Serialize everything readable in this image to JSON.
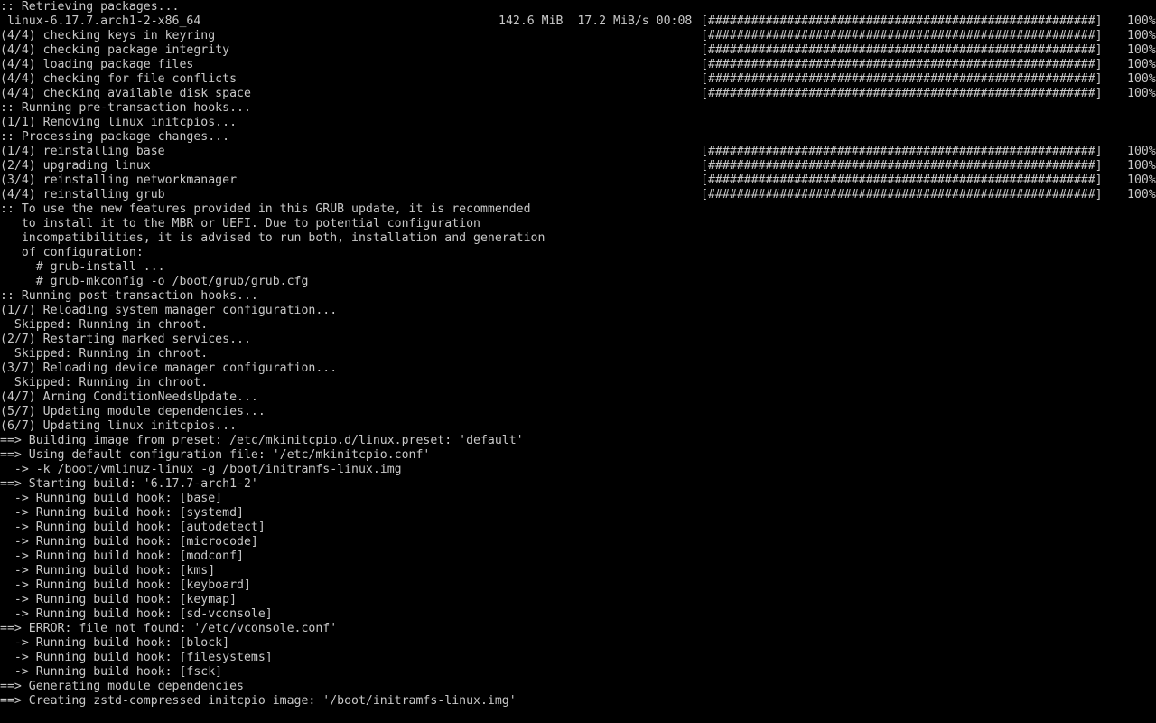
{
  "colors": {
    "background": "#000000",
    "text": "#c8c8c8"
  },
  "console": {
    "lines": [
      {
        "text": ":: Retrieving packages..."
      },
      {
        "text": " linux-6.17.7.arch1-2-x86_64",
        "stats": "142.6 MiB  17.2 MiB/s 00:08",
        "bar": "[######################################################]",
        "pct": "100%"
      },
      {
        "text": "(4/4) checking keys in keyring",
        "bar": "[######################################################]",
        "pct": "100%"
      },
      {
        "text": "(4/4) checking package integrity",
        "bar": "[######################################################]",
        "pct": "100%"
      },
      {
        "text": "(4/4) loading package files",
        "bar": "[######################################################]",
        "pct": "100%"
      },
      {
        "text": "(4/4) checking for file conflicts",
        "bar": "[######################################################]",
        "pct": "100%"
      },
      {
        "text": "(4/4) checking available disk space",
        "bar": "[######################################################]",
        "pct": "100%"
      },
      {
        "text": ":: Running pre-transaction hooks..."
      },
      {
        "text": "(1/1) Removing linux initcpios..."
      },
      {
        "text": ":: Processing package changes..."
      },
      {
        "text": "(1/4) reinstalling base",
        "bar": "[######################################################]",
        "pct": "100%"
      },
      {
        "text": "(2/4) upgrading linux",
        "bar": "[######################################################]",
        "pct": "100%"
      },
      {
        "text": "(3/4) reinstalling networkmanager",
        "bar": "[######################################################]",
        "pct": "100%"
      },
      {
        "text": "(4/4) reinstalling grub",
        "bar": "[######################################################]",
        "pct": "100%"
      },
      {
        "text": ":: To use the new features provided in this GRUB update, it is recommended"
      },
      {
        "text": "   to install it to the MBR or UEFI. Due to potential configuration"
      },
      {
        "text": "   incompatibilities, it is advised to run both, installation and generation"
      },
      {
        "text": "   of configuration:"
      },
      {
        "text": "     # grub-install ..."
      },
      {
        "text": "     # grub-mkconfig -o /boot/grub/grub.cfg"
      },
      {
        "text": ":: Running post-transaction hooks..."
      },
      {
        "text": "(1/7) Reloading system manager configuration..."
      },
      {
        "text": "  Skipped: Running in chroot."
      },
      {
        "text": "(2/7) Restarting marked services..."
      },
      {
        "text": "  Skipped: Running in chroot."
      },
      {
        "text": "(3/7) Reloading device manager configuration..."
      },
      {
        "text": "  Skipped: Running in chroot."
      },
      {
        "text": "(4/7) Arming ConditionNeedsUpdate..."
      },
      {
        "text": "(5/7) Updating module dependencies..."
      },
      {
        "text": "(6/7) Updating linux initcpios..."
      },
      {
        "text": "==> Building image from preset: /etc/mkinitcpio.d/linux.preset: 'default'"
      },
      {
        "text": "==> Using default configuration file: '/etc/mkinitcpio.conf'"
      },
      {
        "text": "  -> -k /boot/vmlinuz-linux -g /boot/initramfs-linux.img"
      },
      {
        "text": "==> Starting build: '6.17.7-arch1-2'"
      },
      {
        "text": "  -> Running build hook: [base]"
      },
      {
        "text": "  -> Running build hook: [systemd]"
      },
      {
        "text": "  -> Running build hook: [autodetect]"
      },
      {
        "text": "  -> Running build hook: [microcode]"
      },
      {
        "text": "  -> Running build hook: [modconf]"
      },
      {
        "text": "  -> Running build hook: [kms]"
      },
      {
        "text": "  -> Running build hook: [keyboard]"
      },
      {
        "text": "  -> Running build hook: [keymap]"
      },
      {
        "text": "  -> Running build hook: [sd-vconsole]"
      },
      {
        "text": "==> ERROR: file not found: '/etc/vconsole.conf'"
      },
      {
        "text": "  -> Running build hook: [block]"
      },
      {
        "text": "  -> Running build hook: [filesystems]"
      },
      {
        "text": "  -> Running build hook: [fsck]"
      },
      {
        "text": "==> Generating module dependencies"
      },
      {
        "text": "==> Creating zstd-compressed initcpio image: '/boot/initramfs-linux.img'"
      }
    ]
  }
}
